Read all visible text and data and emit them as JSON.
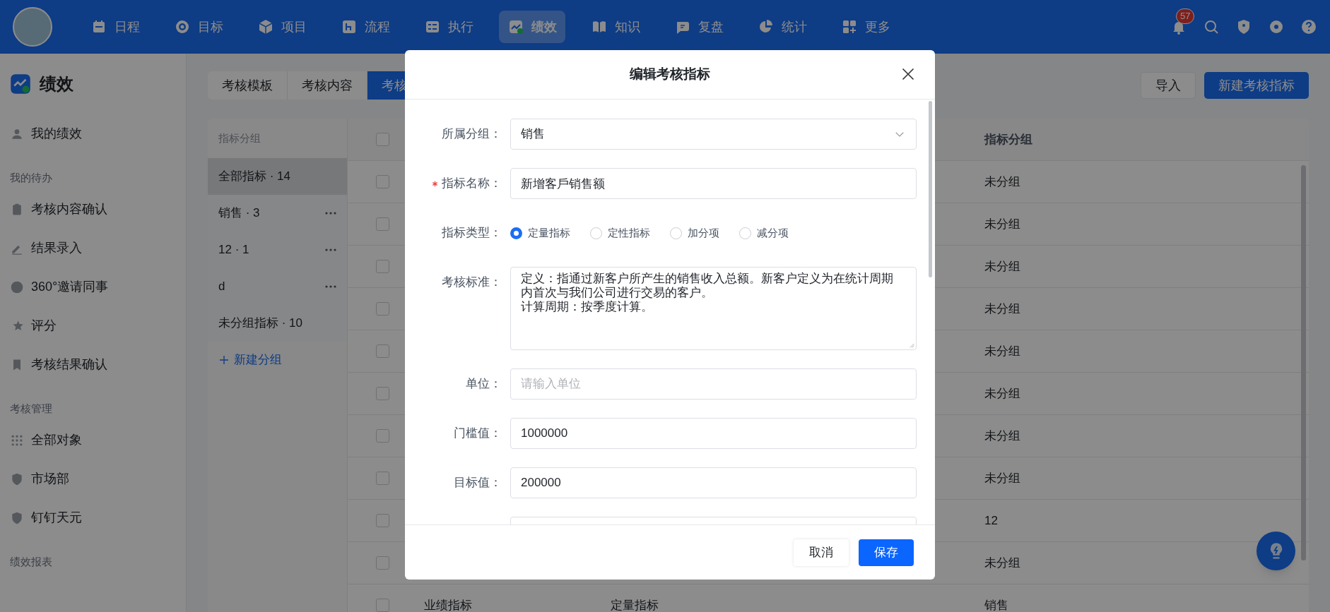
{
  "nav": {
    "items": [
      {
        "label": "日程",
        "selected": false
      },
      {
        "label": "目标",
        "selected": false
      },
      {
        "label": "项目",
        "selected": false
      },
      {
        "label": "流程",
        "selected": false
      },
      {
        "label": "执行",
        "selected": false
      },
      {
        "label": "绩效",
        "selected": true
      },
      {
        "label": "知识",
        "selected": false
      },
      {
        "label": "复盘",
        "selected": false
      },
      {
        "label": "统计",
        "selected": false
      },
      {
        "label": "更多",
        "selected": false
      }
    ],
    "notification_count": "57"
  },
  "sidebar": {
    "title": "绩效",
    "items": [
      {
        "label": "我的绩效"
      }
    ],
    "sections": [
      {
        "heading": "我的待办",
        "items": [
          {
            "label": "考核内容确认"
          },
          {
            "label": "结果录入"
          },
          {
            "label": "360°邀请同事"
          },
          {
            "label": "评分"
          },
          {
            "label": "考核结果确认"
          }
        ]
      },
      {
        "heading": "考核管理",
        "items": [
          {
            "label": "全部对象"
          },
          {
            "label": "市场部"
          },
          {
            "label": "钉钉天元"
          }
        ]
      },
      {
        "heading": "绩效报表"
      }
    ]
  },
  "tabs": [
    {
      "label": "考核模板",
      "selected": false
    },
    {
      "label": "考核内容",
      "selected": false
    },
    {
      "label": "考核",
      "selected": true
    }
  ],
  "toolbar_buttons": [
    {
      "label": "导入",
      "kind": "secondary"
    },
    {
      "label": "新建考核指标",
      "kind": "primary"
    }
  ],
  "group_panel": {
    "heading": "指标分组",
    "items": [
      {
        "label": "全部指标 · 14",
        "selected": true,
        "has_menu": false
      },
      {
        "label": "销售 · 3",
        "selected": false,
        "has_menu": true
      },
      {
        "label": "12 · 1",
        "selected": false,
        "has_menu": true
      },
      {
        "label": "d",
        "selected": false,
        "has_menu": true
      },
      {
        "label": "未分组指标 · 10",
        "selected": false,
        "has_menu": false
      }
    ],
    "add_label": "新建分组"
  },
  "table": {
    "header_checked": false,
    "group_column": "指标分组",
    "rows": [
      {
        "checked": false,
        "group": "未分组"
      },
      {
        "checked": false,
        "group": "未分组"
      },
      {
        "checked": false,
        "group": "未分组"
      },
      {
        "checked": false,
        "group": "未分组"
      },
      {
        "checked": false,
        "group": "未分组"
      },
      {
        "checked": false,
        "group": "未分组"
      },
      {
        "checked": false,
        "group": "未分组"
      },
      {
        "checked": false,
        "group": "未分组"
      },
      {
        "checked": false,
        "group": "12"
      },
      {
        "checked": false,
        "group": "未分组"
      },
      {
        "checked": false,
        "column_2": "业绩指标",
        "column_3": "定量指标",
        "group": "销售"
      }
    ]
  },
  "modal": {
    "title": "编辑考核指标",
    "fields": [
      {
        "kind": "select",
        "label": "所属分组：",
        "required": false,
        "value": "销售"
      },
      {
        "kind": "text",
        "label": "指标名称：",
        "required": true,
        "value": "新增客戶销售额"
      },
      {
        "kind": "radio",
        "label": "指标类型：",
        "required": false,
        "options": [
          {
            "label": "定量指标",
            "selected": true
          },
          {
            "label": "定性指标",
            "selected": false
          },
          {
            "label": "加分项",
            "selected": false
          },
          {
            "label": "减分项",
            "selected": false
          }
        ]
      },
      {
        "kind": "textarea",
        "label": "考核标准：",
        "required": false,
        "lines": [
          "定义：指通过新客户所产生的销售收入总额。新客户定义为在统计周期内首次与我们公司进行交易的客户。",
          "计算周期：按季度计算。"
        ]
      },
      {
        "kind": "text",
        "label": "单位：",
        "required": false,
        "placeholder": "请输入单位"
      },
      {
        "kind": "text",
        "label": "门槛值：",
        "required": false,
        "value": "1000000"
      },
      {
        "kind": "text",
        "label": "目标值：",
        "required": false,
        "value": "200000"
      },
      {
        "kind": "text",
        "required": false
      }
    ],
    "buttons": [
      {
        "label": "取消",
        "kind": "secondary"
      },
      {
        "label": "保存",
        "kind": "primary"
      }
    ]
  }
}
